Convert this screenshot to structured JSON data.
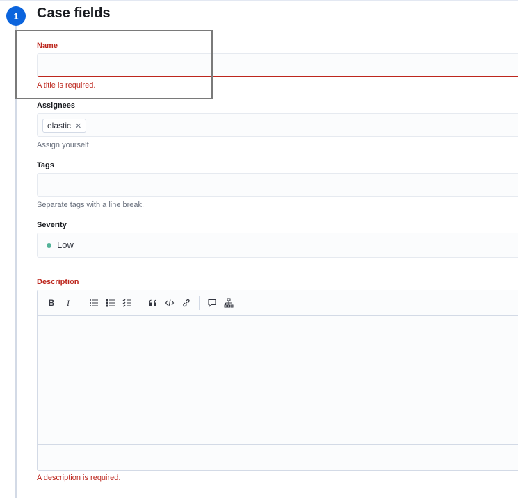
{
  "step": {
    "number": "1",
    "title": "Case fields"
  },
  "name_field": {
    "label": "Name",
    "value": "",
    "error": "A title is required."
  },
  "assignees_field": {
    "label": "Assignees",
    "selected": [
      {
        "label": "elastic",
        "remove_icon": "close-icon"
      }
    ],
    "help": "Assign yourself"
  },
  "tags_field": {
    "label": "Tags",
    "value": "",
    "help": "Separate tags with a line break."
  },
  "severity_field": {
    "label": "Severity",
    "value": "Low",
    "dot_color": "#54b399"
  },
  "description_field": {
    "label": "Description",
    "error": "A description is required.",
    "toolbar": {
      "bold": "B",
      "italic": "I",
      "icons": [
        "bullet-list-icon",
        "numbered-list-icon",
        "checklist-icon",
        "quote-icon",
        "code-icon",
        "link-icon",
        "comment-icon",
        "tree-diagram-icon"
      ]
    }
  },
  "colors": {
    "primary": "#0b64dd",
    "danger": "#bd271e"
  }
}
